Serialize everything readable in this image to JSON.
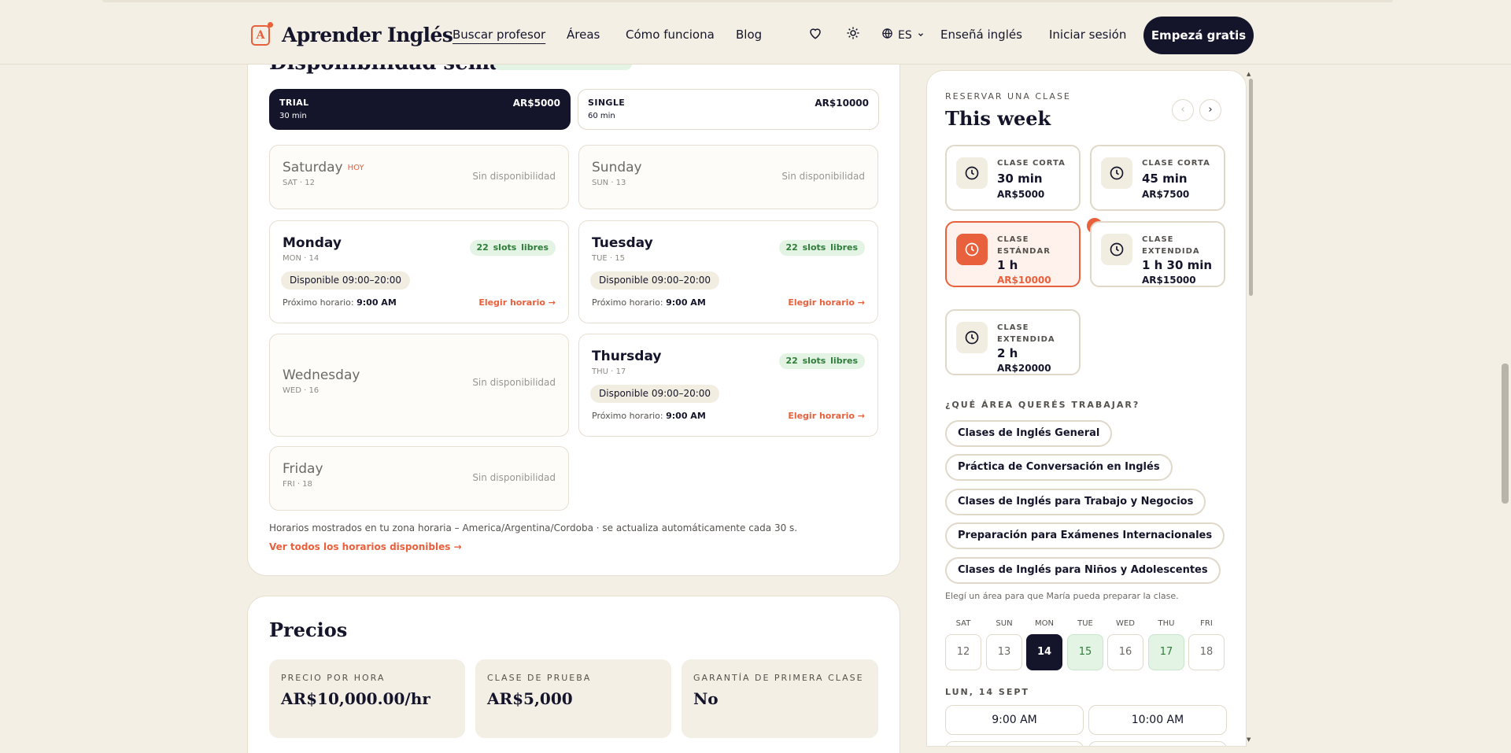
{
  "header": {
    "brand": "Aprender Inglés",
    "logo_letter": "A",
    "nav": [
      "Buscar profesor",
      "Áreas",
      "Cómo funciona",
      "Blog"
    ],
    "lang": "ES",
    "teach": "Enseñá inglés",
    "login": "Iniciar sesión",
    "cta": "Empezá gratis"
  },
  "availability": {
    "title": "Disponibilidad semanal",
    "plans": [
      {
        "name": "TRIAL",
        "duration": "30 min",
        "price": "AR$5000"
      },
      {
        "name": "SINGLE",
        "duration": "60 min",
        "price": "AR$10000"
      }
    ],
    "today_badge": "HOY",
    "no_availability": "Sin disponibilidad",
    "slots_text": "22 slots libres",
    "available_text": "Disponible 09:00–20:00",
    "next_label": "Próximo horario:",
    "next_time": "9:00 AM",
    "pick_text": "Elegir horario →",
    "days": [
      {
        "name": "Saturday",
        "sub": "SAT · 12"
      },
      {
        "name": "Sunday",
        "sub": "SUN · 13"
      },
      {
        "name": "Monday",
        "sub": "MON · 14"
      },
      {
        "name": "Tuesday",
        "sub": "TUE · 15"
      },
      {
        "name": "Wednesday",
        "sub": "WED · 16"
      },
      {
        "name": "Thursday",
        "sub": "THU · 17"
      },
      {
        "name": "Friday",
        "sub": "FRI · 18"
      }
    ],
    "tz_note": "Horarios mostrados en tu zona horaria – America/Argentina/Cordoba · se actualiza automáticamente cada 30 s.",
    "all_link": "Ver todos los horarios disponibles →"
  },
  "prices": {
    "title": "Precios",
    "boxes": [
      {
        "label": "PRECIO POR HORA",
        "value": "AR$10,000.00/hr"
      },
      {
        "label": "CLASE DE PRUEBA",
        "value": "AR$5,000"
      },
      {
        "label": "GARANTÍA DE PRIMERA CLASE",
        "value": "No"
      }
    ]
  },
  "booking": {
    "label": "RESERVAR UNA CLASE",
    "title": "This week",
    "prev": "‹",
    "next": "›",
    "durations": [
      {
        "kind": "CLASE CORTA",
        "time": "30 min",
        "price": "AR$5000"
      },
      {
        "kind": "CLASE CORTA",
        "time": "45 min",
        "price": "AR$7500"
      },
      {
        "kind": "CLASE ESTÁNDAR",
        "time": "1 h",
        "price": "AR$10000"
      },
      {
        "kind": "CLASE EXTENDIDA",
        "time": "1 h 30 min",
        "price": "AR$15000"
      },
      {
        "kind": "CLASE EXTENDIDA",
        "time": "2 h",
        "price": "AR$20000"
      }
    ],
    "selected_duration": 2,
    "area_label": "¿QUÉ ÁREA QUERÉS TRABAJAR?",
    "areas": [
      "Clases de Inglés General",
      "Práctica de Conversación en Inglés",
      "Clases de Inglés para Trabajo y Negocios",
      "Preparación para Exámenes Internacionales",
      "Clases de Inglés para Niños y Adolescentes"
    ],
    "area_hint": "Elegí un área para que María pueda preparar la clase.",
    "calendar": {
      "heads": [
        "SAT",
        "SUN",
        "MON",
        "TUE",
        "WED",
        "THU",
        "FRI"
      ],
      "days": [
        "12",
        "13",
        "14",
        "15",
        "16",
        "17",
        "18"
      ]
    },
    "date_label": "LUN, 14 SEPT",
    "slots": [
      "9:00 AM",
      "10:00 AM"
    ]
  },
  "colors": {
    "accent": "#e8603c",
    "dark": "#14142b",
    "background": "#f4efe4",
    "available_green": "#e3f3e4"
  }
}
